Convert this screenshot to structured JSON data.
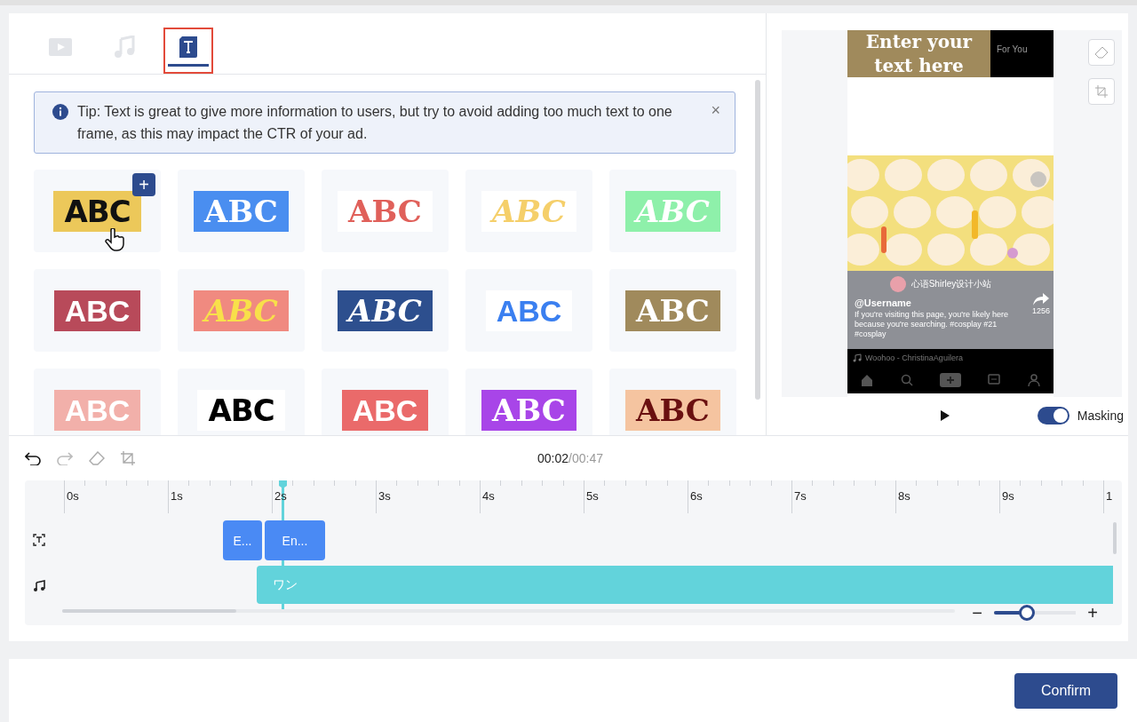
{
  "tabs": [
    {
      "kind": "video",
      "selected": false
    },
    {
      "kind": "music",
      "selected": false
    },
    {
      "kind": "text",
      "selected": true
    }
  ],
  "tip": {
    "text": "Tip: Text is great to give more information to users, but try to avoid adding too much text to one frame, as this may impact the CTR of your ad.",
    "close": "×"
  },
  "styles": [
    {
      "label": {
        "text": "ABC",
        "color": "#111111"
      },
      "kind": "heavy",
      "color": "#ecc85a",
      "add": "+"
    },
    {
      "label": {
        "text": "ABC",
        "color": "#ffffff"
      },
      "kind": "serif",
      "color": "#4a8ef0"
    },
    {
      "label": {
        "text": "ABC",
        "color": "#e0605a"
      },
      "kind": "serif",
      "color": "#ffffff"
    },
    {
      "label": {
        "text": "ABC",
        "color": "#f5cf6a"
      },
      "kind": "italic",
      "color": "#ffffff"
    },
    {
      "label": {
        "text": "ABC",
        "color": "#ffffff"
      },
      "kind": "italic",
      "color": "#8ef0aa"
    },
    {
      "label": {
        "text": "ABC",
        "color": "#ffffff"
      },
      "kind": "sans",
      "color": "#b84a5a"
    },
    {
      "label": {
        "text": "ABC",
        "color": "#f8e04a"
      },
      "kind": "italic",
      "color": "#f08a80"
    },
    {
      "label": {
        "text": "ABC",
        "color": "#ffffff"
      },
      "kind": "italic",
      "color": "#2d4f8e"
    },
    {
      "label": {
        "text": "ABC",
        "color": "#3a7ff0"
      },
      "kind": "sans",
      "color": "#ffffff"
    },
    {
      "label": {
        "text": "ABC",
        "color": "#ffffff"
      },
      "kind": "serif",
      "color": "#a08a5c"
    },
    {
      "label": {
        "text": "ABC",
        "color": "#ffffff"
      },
      "kind": "sans",
      "color": "#f2b0aa"
    },
    {
      "label": {
        "text": "ABC",
        "color": "#000000"
      },
      "kind": "heavy",
      "color": "#ffffff"
    },
    {
      "label": {
        "text": "ABC",
        "color": "#ffffff"
      },
      "kind": "sans",
      "color": "#ea6a6a"
    },
    {
      "label": {
        "text": "ABC",
        "color": "#ffffff"
      },
      "kind": "serif",
      "color": "#a845e8"
    },
    {
      "label": {
        "text": "ABC",
        "color": "#6a1010"
      },
      "kind": "serif",
      "color": "#f5c4a0"
    }
  ],
  "preview": {
    "overlay_text": "Enter your text here",
    "feed_tab": "For You",
    "author": "心语Shirley设计小站",
    "username": "@Username",
    "caption": "If you're visiting this page, you're likely here because you're searching. #cosplay #21 #cosplay",
    "share_count": "1256",
    "song": "Woohoo - ChristinaAguilera",
    "masking": {
      "label": "Masking",
      "on": true
    }
  },
  "timeline": {
    "current": "00:02",
    "total": "/00:47",
    "ruler": [
      "0s",
      "1s",
      "2s",
      "3s",
      "4s",
      "5s",
      "6s",
      "7s",
      "8s",
      "9s",
      "1"
    ],
    "text_clips": [
      "E...",
      "En..."
    ],
    "audio_clip": "ワン",
    "zoom": {
      "minus": "−",
      "plus": "+",
      "level": 0.4
    }
  },
  "confirm": "Confirm"
}
